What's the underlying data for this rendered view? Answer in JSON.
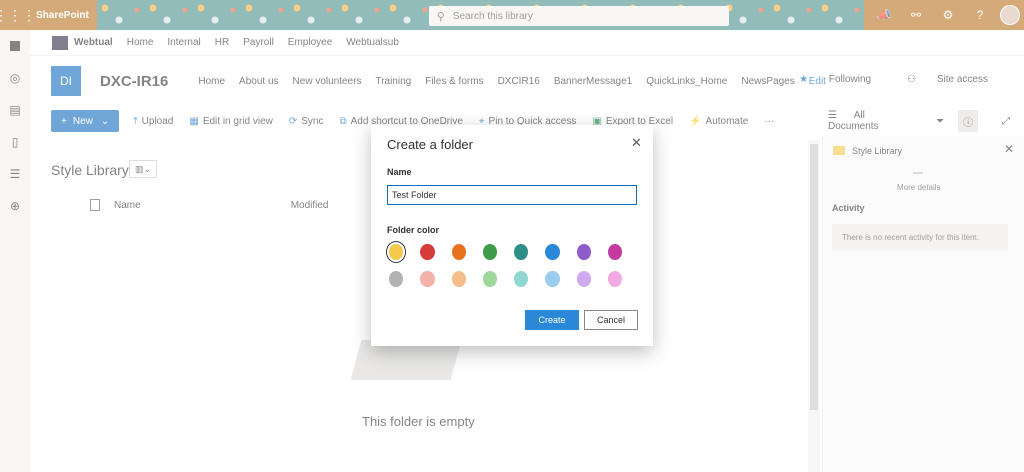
{
  "suite": {
    "brand": "SharePoint",
    "search_placeholder": "Search this library",
    "icons": [
      "megaphone-icon",
      "share-icon",
      "settings-icon",
      "help-icon",
      "avatar"
    ]
  },
  "hub": {
    "name": "Webtual",
    "items": [
      "Home",
      "Internal",
      "HR",
      "Payroll",
      "Employee",
      "Webtualsub"
    ]
  },
  "site": {
    "logo": "DI",
    "title": "DXC-IR16",
    "nav": [
      "Home",
      "About us",
      "New volunteers",
      "Training",
      "Files & forms",
      "DXCIR16",
      "BannerMessage1",
      "QuickLinks_Home",
      "NewsPages"
    ],
    "edit": "Edit",
    "following": "Following",
    "site_access": "Site access"
  },
  "commands": {
    "new": "New",
    "upload": "Upload",
    "edit_grid": "Edit in grid view",
    "sync": "Sync",
    "add_shortcut": "Add shortcut to OneDrive",
    "pin": "Pin to Quick access",
    "export": "Export to Excel",
    "automate": "Automate",
    "more": "···",
    "view": "All Documents"
  },
  "library": {
    "title": "Style Library",
    "col_name": "Name",
    "col_modified": "Modified",
    "empty": "This folder is empty"
  },
  "details": {
    "title": "Style Library",
    "more": "More details",
    "activity": "Activity",
    "no_activity": "There is no recent activity for this item."
  },
  "dialog": {
    "title": "Create a folder",
    "name_label": "Name",
    "name_value": "Test Folder",
    "color_label": "Folder color",
    "colors_row1": [
      "#f2c94c",
      "#d83b3b",
      "#e8711f",
      "#3d9b4a",
      "#2f8f86",
      "#2b88d8",
      "#8f5bc8",
      "#c43a9f"
    ],
    "colors_row2": [
      "#b3b3b3",
      "#f2b3ab",
      "#f5bd8a",
      "#9ed69b",
      "#8fd8cf",
      "#9cccf0",
      "#cfaaf0",
      "#f0a9e2"
    ],
    "selected_color": "#f2c94c",
    "create": "Create",
    "cancel": "Cancel"
  }
}
